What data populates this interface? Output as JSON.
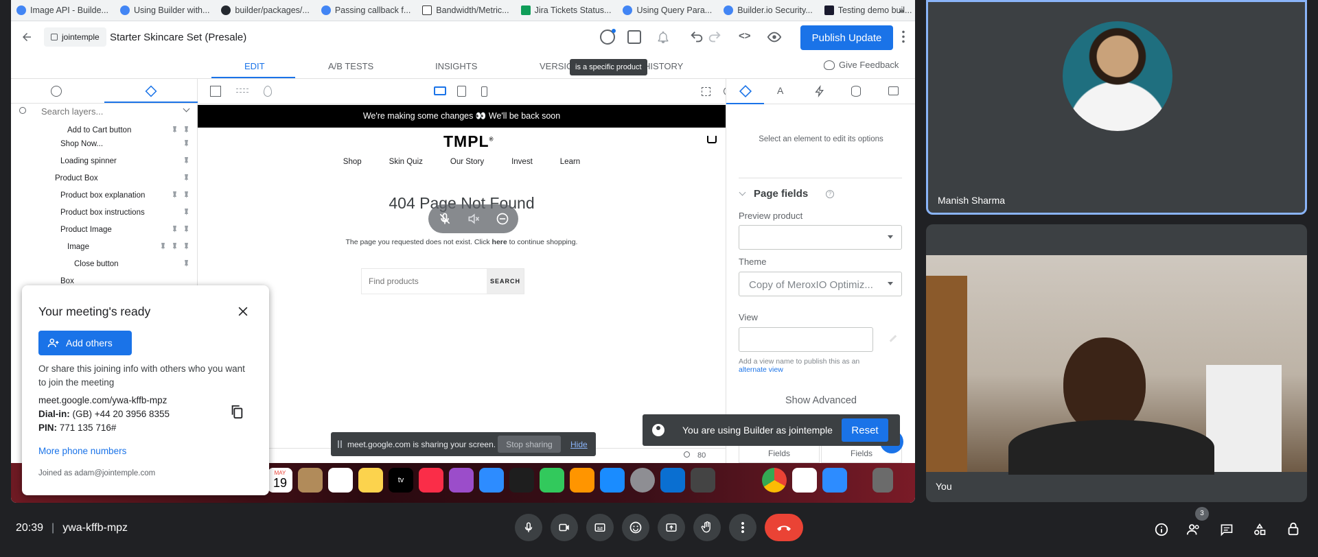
{
  "bookmarks": [
    "Image API - Builde...",
    "Using Builder with...",
    "builder/packages/...",
    "Passing callback f...",
    "Bandwidth/Metric...",
    "Jira Tickets Status...",
    "Using Query Para...",
    "Builder.io Security...",
    "Testing demo buil..."
  ],
  "bookmarks_more": "»",
  "toolbar": {
    "org": "jointemple",
    "page_title": "Starter Skincare Set (Presale)",
    "publish_label": "Publish Update"
  },
  "tabs": [
    "EDIT",
    "A/B TESTS",
    "INSIGHTS",
    "VERSIO",
    "HISTORY"
  ],
  "tooltip": "is a specific product",
  "feedback": "Give Feedback",
  "layers": {
    "search_placeholder": "Search layers...",
    "items": [
      "Add to Cart button",
      "Shop Now...",
      "Loading spinner",
      "Product Box",
      "Product box explanation",
      "Product box instructions",
      "Product Image",
      "Image",
      "Close button",
      "Box"
    ]
  },
  "site": {
    "banner": "We're making some changes 👀 We'll be back soon",
    "logo": "TMPL",
    "nav": [
      "Shop",
      "Skin Quiz",
      "Our Story",
      "Invest",
      "Learn"
    ],
    "heading": "404 Page Not Found",
    "msg_pre": "The page you requested does not exist. Click ",
    "msg_link": "here",
    "msg_post": " to continue shopping.",
    "search_placeholder": "Find products",
    "search_button": "SEARCH"
  },
  "right_panel": {
    "hint": "Select an element to edit its options",
    "page_fields": "Page fields",
    "preview_product_label": "Preview product",
    "theme_label": "Theme",
    "theme_value": "Copy of MeroxIO Optimiz...",
    "view_label": "View",
    "view_hint": "Add a view name to publish this as an",
    "view_hint_link": "alternate view",
    "show_advanced": "Show Advanced",
    "fields_tab_1": "Fields",
    "fields_tab_2": "Fields",
    "zoom": "80"
  },
  "builder_toast": {
    "text": "You are using Builder as jointemple",
    "reset_label": "Reset"
  },
  "share_bar": {
    "text": "meet.google.com is sharing your screen.",
    "stop_label": "Stop sharing",
    "hide_label": "Hide"
  },
  "dock": {
    "calendar_month": "MAY",
    "calendar_day": "19"
  },
  "participants": {
    "tile1_name": "Manish Sharma",
    "tile2_name": "You"
  },
  "meeting": {
    "time": "20:39",
    "code": "ywa-kffb-mpz",
    "people_count": "3"
  },
  "popup": {
    "title": "Your meeting's ready",
    "add_others": "Add others",
    "share_text": "Or share this joining info with others who you want to join the meeting",
    "link": "meet.google.com/ywa-kffb-mpz",
    "dialin_label": "Dial-in:",
    "dialin_value": "(GB) +44 20 3956 8355",
    "pin_label": "PIN:",
    "pin_value": "771 135 716#",
    "more_numbers": "More phone numbers",
    "joined_as": "Joined as adam@jointemple.com"
  },
  "colors": {
    "accent": "#1a73e8",
    "end_call": "#ea4335",
    "tile_border": "#8ab4f8",
    "meet_bg": "#202124"
  }
}
